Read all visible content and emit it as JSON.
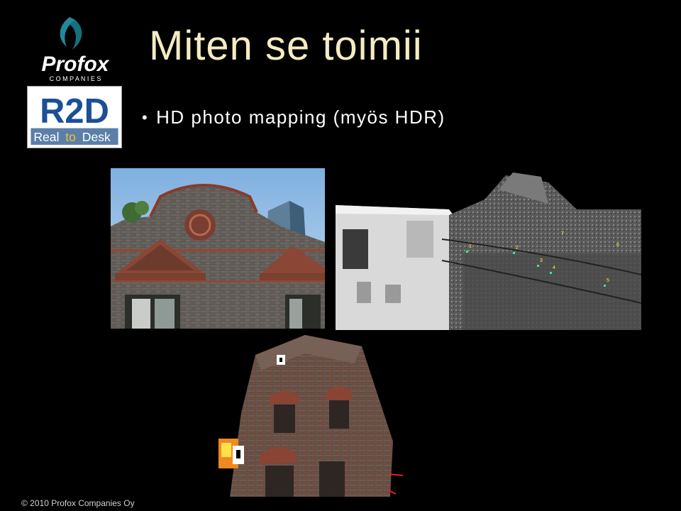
{
  "slide": {
    "title": "Miten se toimii",
    "bullet": "HD photo mapping (myös HDR)",
    "footer": "© 2010 Profox Companies Oy"
  },
  "logos": {
    "profox": {
      "wordmark": "Profox",
      "sub": "C O M P A N I E S"
    },
    "r2d": {
      "mark": "R2D",
      "tagline_1": "Real",
      "tagline_2": "to",
      "tagline_3": "Desk"
    }
  },
  "images": {
    "photo_1": "brick-building-facade-photo",
    "photo_2": "point-cloud-scan-image",
    "photo_3": "textured-3d-model-image"
  },
  "colors": {
    "background": "#000000",
    "title": "#f4ecc2",
    "profox_teal": "#1f8a9a",
    "r2d_blue": "#1b4f96"
  },
  "scan_markers": [
    "1",
    "2",
    "3",
    "4",
    "5",
    "6",
    "7"
  ]
}
